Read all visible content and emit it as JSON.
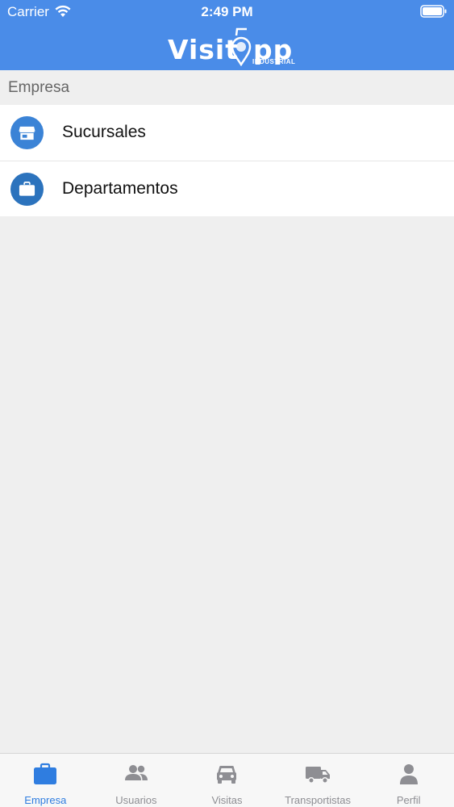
{
  "status_bar": {
    "carrier": "Carrier",
    "time": "2:49 PM"
  },
  "header": {
    "logo_text": "Visit",
    "logo_text_tail": "pp",
    "logo_sub": "INDUSTRIAL",
    "background": "#4a8ce8"
  },
  "section": {
    "title": "Empresa"
  },
  "list": {
    "items": [
      {
        "label": "Sucursales",
        "icon": "store-icon"
      },
      {
        "label": "Departamentos",
        "icon": "briefcase-icon"
      }
    ]
  },
  "tabbar": {
    "active_color": "#2f7de0",
    "inactive_color": "#8e8e93",
    "tabs": [
      {
        "label": "Empresa",
        "icon": "briefcase-icon",
        "active": true
      },
      {
        "label": "Usuarios",
        "icon": "users-icon",
        "active": false
      },
      {
        "label": "Visitas",
        "icon": "car-icon",
        "active": false
      },
      {
        "label": "Transportistas",
        "icon": "truck-icon",
        "active": false
      },
      {
        "label": "Perfil",
        "icon": "person-icon",
        "active": false
      }
    ]
  }
}
